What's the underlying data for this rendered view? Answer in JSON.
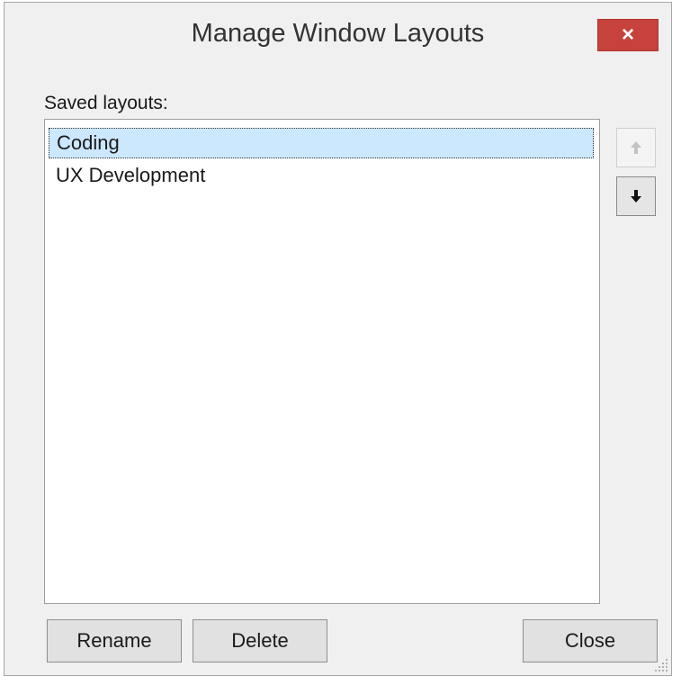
{
  "window": {
    "title": "Manage Window Layouts",
    "close_glyph": "×"
  },
  "saved_layouts": {
    "label": "Saved layouts:",
    "items": [
      {
        "label": "Coding",
        "selected": true
      },
      {
        "label": "UX Development",
        "selected": false
      }
    ]
  },
  "reorder": {
    "up_icon": "arrow-up-icon",
    "down_icon": "arrow-down-icon",
    "up_enabled": false,
    "down_enabled": true
  },
  "buttons": {
    "rename": "Rename",
    "delete": "Delete",
    "close": "Close"
  },
  "colors": {
    "selection": "#cce8ff",
    "close_button": "#c7423d"
  }
}
